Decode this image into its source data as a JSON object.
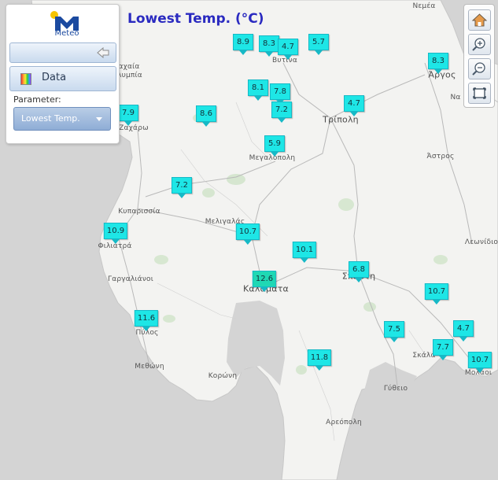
{
  "title": "Lowest Temp. (°C)",
  "logo": {
    "text": "Meteo"
  },
  "panel": {
    "data_label": "Data",
    "parameter_label": "Parameter:",
    "parameter_value": "Lowest Temp."
  },
  "zoom_controls": [
    "home-icon",
    "zoom-in-icon",
    "zoom-out-icon",
    "full-extent-icon"
  ],
  "towns": [
    {
      "name": "Νεμέα"
    },
    {
      "name": "Βυτινα"
    },
    {
      "name": "Άργος"
    },
    {
      "name": "Τρίπολη"
    },
    {
      "name": "Ζαχάρω"
    },
    {
      "name": "αχαία"
    },
    {
      "name": "λυμπία"
    },
    {
      "name": "Μεγαλόπολη"
    },
    {
      "name": "Άστρος"
    },
    {
      "name": "Κυπαρισσία"
    },
    {
      "name": "Μελιγαλάς"
    },
    {
      "name": "Λεωνίδιο"
    },
    {
      "name": "Φιλιατρά"
    },
    {
      "name": "Γαργαλιάνοι"
    },
    {
      "name": "Σπάρτη"
    },
    {
      "name": "Καλαμάτα"
    },
    {
      "name": "Πύλος"
    },
    {
      "name": "Σκάλα"
    },
    {
      "name": "Μεθώνη"
    },
    {
      "name": "Μολάοι"
    },
    {
      "name": "Κορώνη"
    },
    {
      "name": "Γύθειο"
    },
    {
      "name": "Αρεόπολη"
    },
    {
      "name": "Να"
    }
  ],
  "stations": [
    {
      "value": "8.9"
    },
    {
      "value": "8.3"
    },
    {
      "value": "4.7"
    },
    {
      "value": "5.7"
    },
    {
      "value": "8.3"
    },
    {
      "value": "8.1"
    },
    {
      "value": "7.8"
    },
    {
      "value": "7.2"
    },
    {
      "value": "4.7"
    },
    {
      "value": "7.9"
    },
    {
      "value": "8.6"
    },
    {
      "value": "5.9"
    },
    {
      "value": "7.2"
    },
    {
      "value": "10.9"
    },
    {
      "value": "10.7"
    },
    {
      "value": "10.1"
    },
    {
      "value": "6.8"
    },
    {
      "value": "12.6"
    },
    {
      "value": "10.7"
    },
    {
      "value": "11.6"
    },
    {
      "value": "7.5"
    },
    {
      "value": "4.7"
    },
    {
      "value": "7.7"
    },
    {
      "value": "11.8"
    },
    {
      "value": "10.7"
    }
  ]
}
